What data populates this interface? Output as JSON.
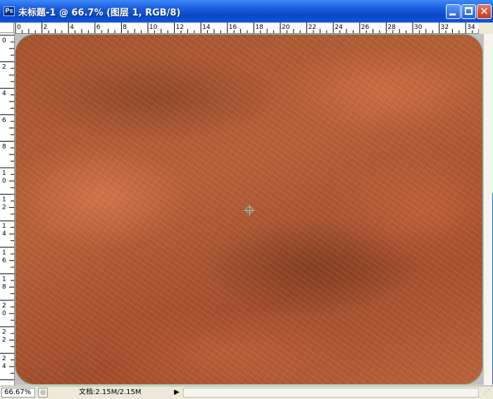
{
  "window": {
    "title": "未标题-1 @ 66.7% (图层 1, RGB/8)",
    "app_icon": "Ps"
  },
  "title_buttons": {
    "minimize_icon": "minimize-icon",
    "maximize_icon": "maximize-icon",
    "close_label": "✕"
  },
  "ruler_top": {
    "labels": [
      "0",
      "2",
      "4",
      "6",
      "8",
      "10",
      "12",
      "14",
      "16",
      "18",
      "20",
      "22",
      "24",
      "26",
      "28",
      "30",
      "32",
      "34"
    ]
  },
  "ruler_left": {
    "labels": [
      "0",
      "2",
      "4",
      "6",
      "8",
      "10",
      "12",
      "14",
      "16",
      "18",
      "20",
      "22",
      "24"
    ]
  },
  "canvas": {
    "fill_colors": [
      "#a5522f",
      "#b5603a",
      "#d0764a"
    ],
    "guide_color": "#7fc4b4"
  },
  "status": {
    "zoom": "66.67%",
    "doc_info": "文档:2.15M/2.15M",
    "arrow": "▶"
  }
}
